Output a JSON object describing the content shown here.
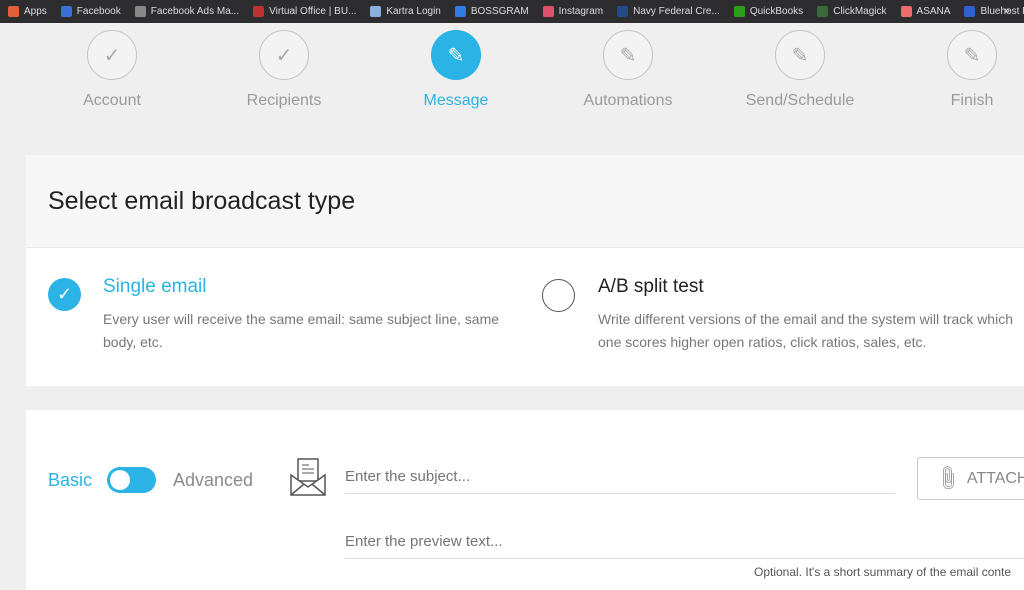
{
  "bookmarks": [
    {
      "label": "Apps",
      "color": "#e0603a"
    },
    {
      "label": "Facebook",
      "color": "#3b6fd8"
    },
    {
      "label": "Facebook Ads Ma...",
      "color": "#888888"
    },
    {
      "label": "Virtual Office | BU...",
      "color": "#c03030"
    },
    {
      "label": "Kartra Login",
      "color": "#8ab0e0"
    },
    {
      "label": "BOSSGRAM",
      "color": "#2f7de0"
    },
    {
      "label": "Instagram",
      "color": "#e0506a"
    },
    {
      "label": "Navy Federal Cre...",
      "color": "#234a8a"
    },
    {
      "label": "QuickBooks",
      "color": "#2ca01c"
    },
    {
      "label": "ClickMagick",
      "color": "#3a6a3a"
    },
    {
      "label": "ASANA",
      "color": "#f06a6a"
    },
    {
      "label": "Bluehost Portal",
      "color": "#3060d0"
    }
  ],
  "bookmarks_more": "»",
  "steps": [
    {
      "label": "Account",
      "icon": "check-icon",
      "state": "done"
    },
    {
      "label": "Recipients",
      "icon": "check-icon",
      "state": "done"
    },
    {
      "label": "Message",
      "icon": "pencil-icon",
      "state": "active"
    },
    {
      "label": "Automations",
      "icon": "pencil-icon",
      "state": "pending"
    },
    {
      "label": "Send/Schedule",
      "icon": "pencil-icon",
      "state": "pending"
    },
    {
      "label": "Finish",
      "icon": "pencil-icon",
      "state": "pending"
    }
  ],
  "broadcast": {
    "title": "Select email broadcast type",
    "single": {
      "title": "Single email",
      "desc": "Every user will receive the same email: same subject line, same body, etc.",
      "selected": true
    },
    "ab": {
      "title": "A/B split test",
      "desc": "Write different versions of the email and the system will track which one scores higher open ratios, click ratios, sales, etc.",
      "selected": false
    }
  },
  "editor": {
    "basic_label": "Basic",
    "advanced_label": "Advanced",
    "mode": "Basic",
    "subject_placeholder": "Enter the subject...",
    "preview_placeholder": "Enter the preview text...",
    "attach_label": "ATTACH",
    "preview_hint": "Optional. It's a short summary of the email conte"
  },
  "accent": "#2ab3e4"
}
